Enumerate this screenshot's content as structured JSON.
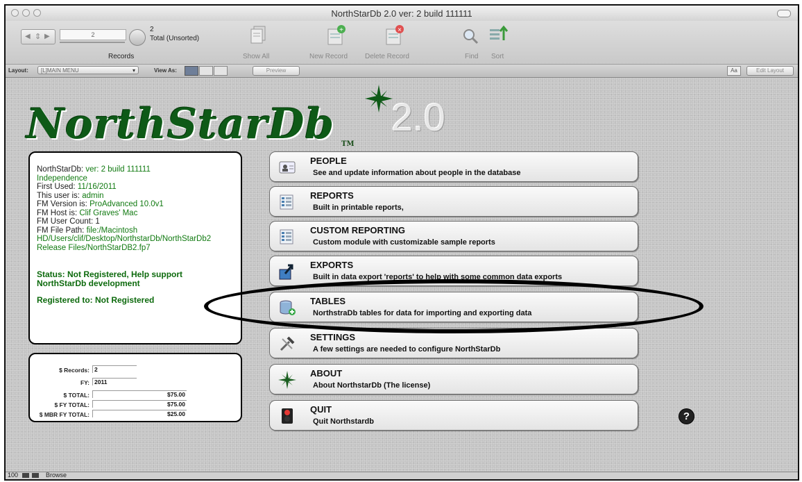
{
  "window": {
    "title": "NorthStarDb 2.0  ver: 2 build 111111"
  },
  "toolbar": {
    "record_number": "2",
    "records_count": "2",
    "records_status": "Total (Unsorted)",
    "records_label": "Records",
    "show_all": "Show All",
    "new_record": "New Record",
    "delete_record": "Delete Record",
    "find": "Find",
    "sort": "Sort"
  },
  "layout_bar": {
    "layout_label": "Layout:",
    "layout_value": "[L]MAIN MENU",
    "view_as_label": "View As:",
    "preview": "Preview",
    "aa": "Aa",
    "edit_layout": "Edit Layout"
  },
  "logo": {
    "name": "NorthStarDb",
    "version": "2.0",
    "tm": "TM"
  },
  "info": {
    "line1_label": "NorthStarDb:",
    "line1_value": "ver: 2 build 111111",
    "line2": "Independence",
    "first_used_label": "First Used:",
    "first_used": "11/16/2011",
    "user_label": "This user is:",
    "user": "admin",
    "fm_version_label": "FM Version is:",
    "fm_version": "ProAdvanced 10.0v1",
    "fm_host_label": "FM Host is:",
    "fm_host": "Clif Graves' Mac",
    "fm_user_count": "FM User Count: 1",
    "fm_path_label": "FM File Path:",
    "fm_path1": "file:/Macintosh",
    "fm_path2": "HD/Users/clif/Desktop/NorthstarDb/NorthStarDb2",
    "fm_path3": "Release Files/NorthStarDB2.fp7",
    "status_line1": "Status: Not Registered, Help support",
    "status_line2": "NorthStarDb development",
    "registered": "Registered to: Not Registered"
  },
  "finance": {
    "records_label": "$ Records:",
    "records_value": "2",
    "fy_label": "FY:",
    "fy_value": "2011",
    "total_label": "$ TOTAL:",
    "total_value": "$75.00",
    "fy_total_label": "$ FY TOTAL:",
    "fy_total_value": "$75.00",
    "mbr_label": "$ MBR FY TOTAL:",
    "mbr_value": "$25.00"
  },
  "menu": [
    {
      "title": "PEOPLE",
      "desc": "See and update information about people in the database",
      "icon": "people-card-icon"
    },
    {
      "title": "REPORTS",
      "desc": "Built in printable reports,",
      "icon": "report-icon"
    },
    {
      "title": "CUSTOM REPORTING",
      "desc": "Custom module with customizable sample reports",
      "icon": "custom-report-icon"
    },
    {
      "title": "EXPORTS",
      "desc": "Built in data export 'reports' to help with some common data exports",
      "icon": "export-icon"
    },
    {
      "title": "TABLES",
      "desc": "NorthstraDb tables for data for importing and exporting data",
      "icon": "database-add-icon"
    },
    {
      "title": "SETTINGS",
      "desc": "A few settings are needed to configure NorthStarDb",
      "icon": "tools-icon"
    },
    {
      "title": "ABOUT",
      "desc": "About NorthstarDb (The license)",
      "icon": "star-icon"
    },
    {
      "title": "QUIT",
      "desc": "Quit Northstardb",
      "icon": "traffic-light-icon"
    }
  ],
  "help": "?",
  "status_bar": {
    "zoom": "100",
    "mode": "Browse"
  }
}
